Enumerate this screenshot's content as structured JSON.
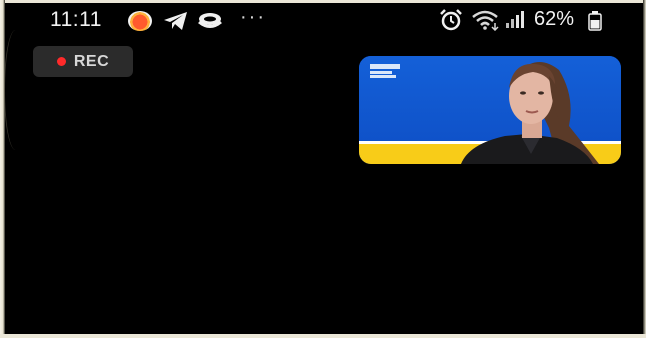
{
  "status_bar": {
    "time": "11:11",
    "more": "···",
    "battery_percent": "62%",
    "icons": [
      "orange-app-icon",
      "telegram-icon",
      "cloud-icon",
      "alarm-icon",
      "wifi-icon",
      "signal-icon",
      "battery-icon"
    ]
  },
  "recording": {
    "label": "REC",
    "color": "#ff2a2a"
  },
  "video": {
    "background_colors": [
      "#0f52c9",
      "#f8cc18"
    ]
  }
}
